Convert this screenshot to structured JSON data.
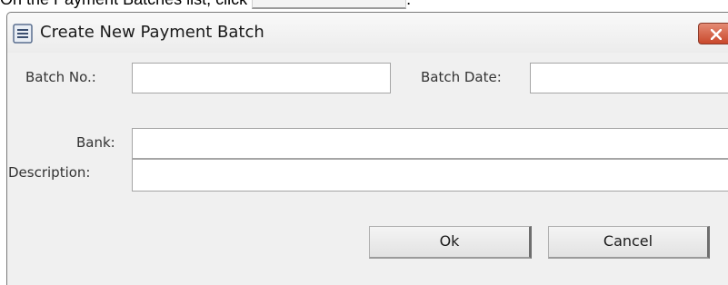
{
  "caption": {
    "text": "On the Payment Batches list, click",
    "suffix": "."
  },
  "dialog": {
    "title": "Create New Payment Batch",
    "icons": {
      "title": "batch-list-icon",
      "close": "close-x-icon"
    },
    "colors": {
      "close_button": "#d2573d",
      "background": "#f0f0f0"
    },
    "fields": {
      "batch_no": {
        "label": "Batch No.:",
        "value": ""
      },
      "batch_date": {
        "label": "Batch Date:",
        "value": ""
      },
      "bank": {
        "label": "Bank:",
        "value": ""
      },
      "description": {
        "label": "Description:",
        "value": ""
      }
    },
    "buttons": {
      "ok": "Ok",
      "cancel": "Cancel"
    }
  }
}
